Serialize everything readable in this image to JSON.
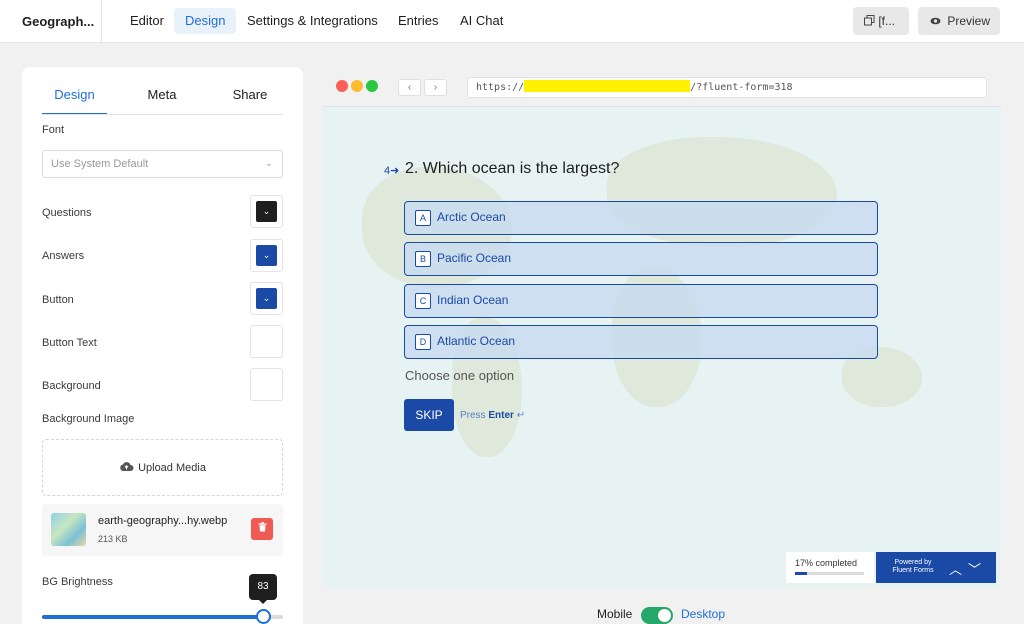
{
  "app": {
    "title": "Geograph..."
  },
  "nav": {
    "tabs": [
      {
        "label": "Editor",
        "active": false
      },
      {
        "label": "Design",
        "active": true
      },
      {
        "label": "Settings & Integrations",
        "active": false
      },
      {
        "label": "Entries",
        "active": false
      },
      {
        "label": "AI Chat",
        "active": false
      }
    ],
    "shortcode_label": "[f...",
    "preview_label": "Preview"
  },
  "panel": {
    "tabs": [
      "Design",
      "Meta",
      "Share"
    ],
    "active_tab": "Design",
    "font_label": "Font",
    "font_value": "Use System Default",
    "colors": [
      {
        "label": "Questions",
        "color": "#1f1f1f"
      },
      {
        "label": "Answers",
        "color": "#1a4aa6"
      },
      {
        "label": "Button",
        "color": "#1a4aa6"
      },
      {
        "label": "Button Text",
        "color": "#ffffff"
      },
      {
        "label": "Background",
        "color": "#ffffff"
      }
    ],
    "bg_image_label": "Background Image",
    "upload_label": "Upload Media",
    "file": {
      "name": "earth-geography...hy.webp",
      "size": "213 KB"
    },
    "brightness_label": "BG Brightness",
    "brightness_value": "83",
    "brightness_fraction": 0.92
  },
  "preview": {
    "url_prefix": "https://",
    "url_suffix": "/?fluent-form=318",
    "question_number": "4",
    "question": "2. Which ocean is the largest?",
    "options": [
      {
        "key": "A",
        "label": "Arctic Ocean"
      },
      {
        "key": "B",
        "label": "Pacific Ocean"
      },
      {
        "key": "C",
        "label": "Indian Ocean"
      },
      {
        "key": "D",
        "label": "Atlantic Ocean"
      }
    ],
    "hint": "Choose one option",
    "skip_label": "SKIP",
    "press_label": "Press",
    "enter_label": "Enter",
    "progress_text": "17% completed",
    "progress_fraction": 0.17,
    "powered_line1": "Powered by",
    "powered_line2": "Fluent Forms"
  },
  "device_toggle": {
    "mobile_label": "Mobile",
    "desktop_label": "Desktop",
    "desktop_on": true
  },
  "colors": {
    "accent": "#1e6fd9",
    "form_blue": "#1a4aa6",
    "toggle_green": "#25a76a",
    "danger": "#ef5b53"
  }
}
